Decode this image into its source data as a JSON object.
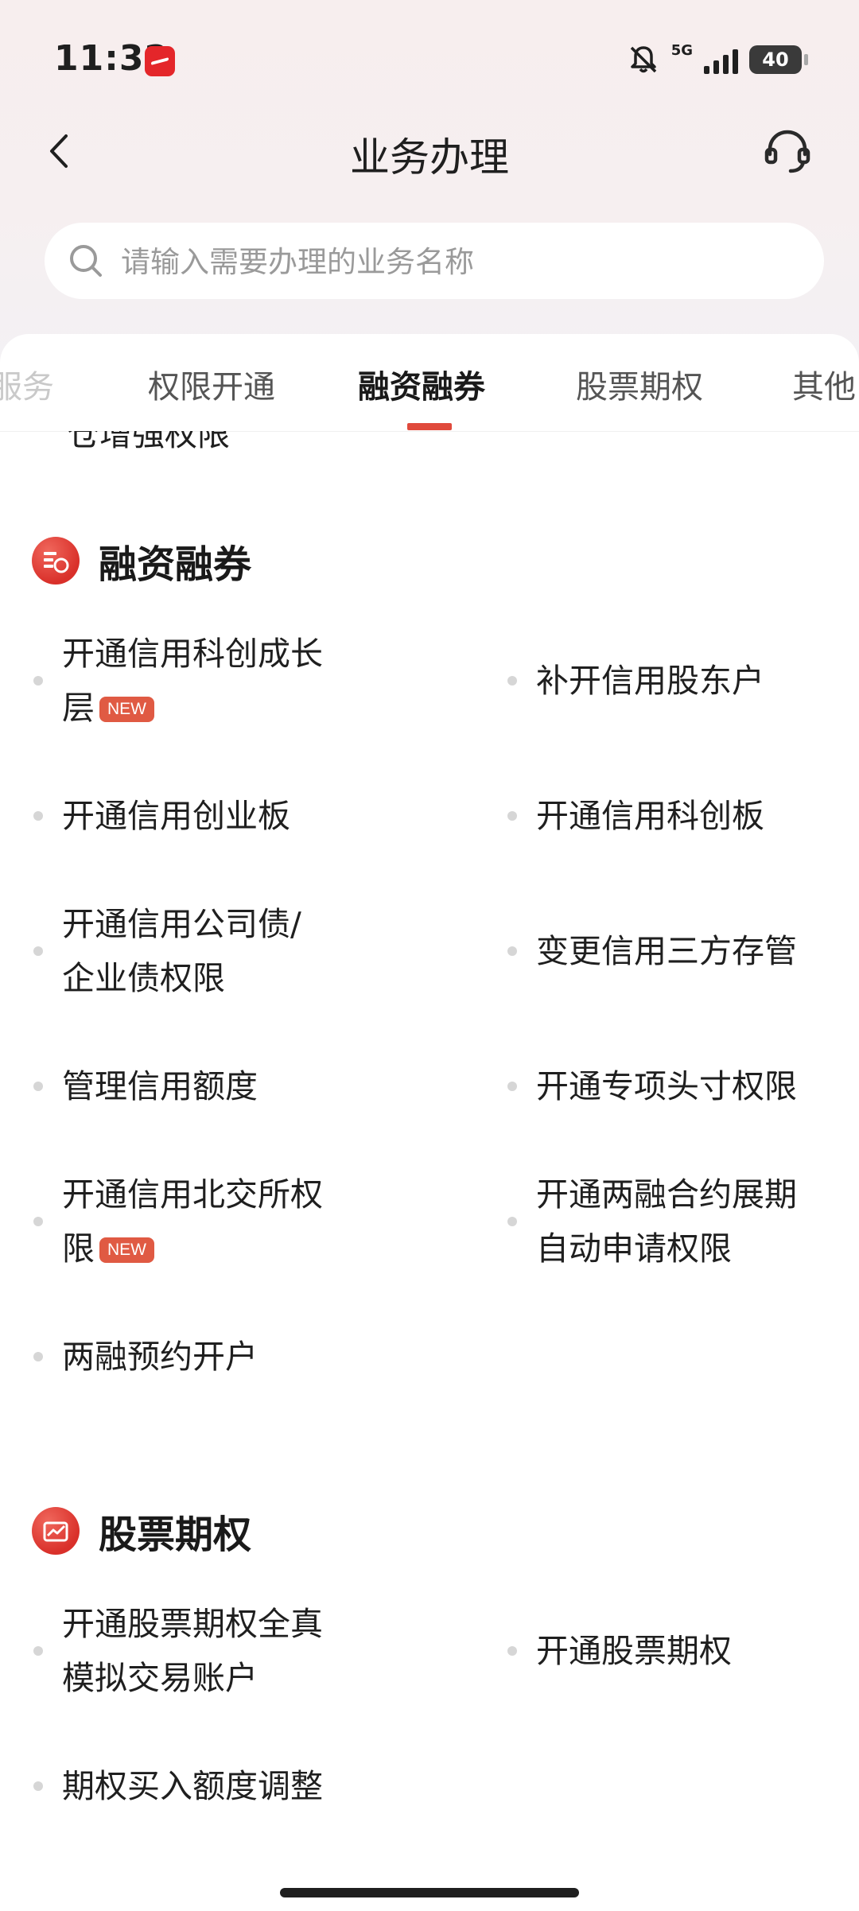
{
  "status_bar": {
    "time": "11:32",
    "network": "5G",
    "battery": "40"
  },
  "header": {
    "title": "业务办理"
  },
  "search": {
    "placeholder": "请输入需要办理的业务名称"
  },
  "tabs": [
    {
      "label": "服务"
    },
    {
      "label": "权限开通"
    },
    {
      "label": "融资融券"
    },
    {
      "label": "股票期权"
    },
    {
      "label": "其他"
    }
  ],
  "active_tab": "融资融券",
  "clipped_item": "仓增强权限",
  "new_badge": "NEW",
  "sections": {
    "margin": {
      "title": "融资融券",
      "items": [
        {
          "label": "开通信用科创成长层",
          "new": true
        },
        {
          "label": "补开信用股东户"
        },
        {
          "label": "开通信用创业板"
        },
        {
          "label": "开通信用科创板"
        },
        {
          "label": "开通信用公司债/企业债权限"
        },
        {
          "label": "变更信用三方存管"
        },
        {
          "label": "管理信用额度"
        },
        {
          "label": "开通专项头寸权限"
        },
        {
          "label": "开通信用北交所权限",
          "new": true
        },
        {
          "label": "开通两融合约展期自动申请权限"
        },
        {
          "label": "两融预约开户"
        }
      ]
    },
    "options": {
      "title": "股票期权",
      "items": [
        {
          "label": "开通股票期权全真模拟交易账户"
        },
        {
          "label": "开通股票期权"
        },
        {
          "label": "期权买入额度调整"
        }
      ]
    }
  },
  "colors": {
    "accent": "#e04a3c",
    "badge": "#e05a43",
    "icon": "#d9302a"
  }
}
